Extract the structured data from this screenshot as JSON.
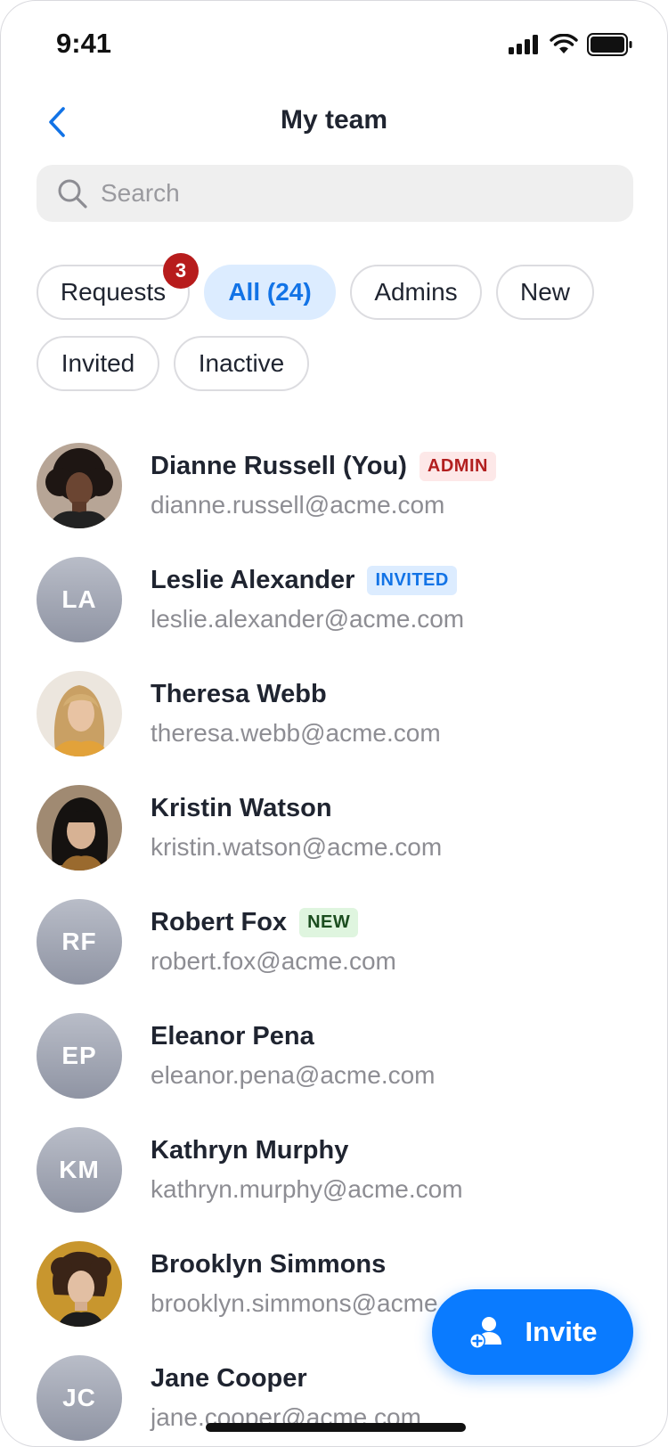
{
  "status_bar": {
    "time": "9:41"
  },
  "header": {
    "title": "My team"
  },
  "search": {
    "placeholder": "Search"
  },
  "filters": [
    {
      "label": "Requests",
      "badge": "3",
      "active": false
    },
    {
      "label": "All (24)",
      "active": true
    },
    {
      "label": "Admins",
      "active": false
    },
    {
      "label": "New",
      "active": false
    },
    {
      "label": "Invited",
      "active": false
    },
    {
      "label": "Inactive",
      "active": false
    }
  ],
  "members": [
    {
      "name": "Dianne Russell (You)",
      "email": "dianne.russell@acme.com",
      "tag": "ADMIN",
      "avatar": "photo"
    },
    {
      "name": "Leslie Alexander",
      "email": "leslie.alexander@acme.com",
      "tag": "INVITED",
      "initials": "LA"
    },
    {
      "name": "Theresa Webb",
      "email": "theresa.webb@acme.com",
      "avatar": "photo"
    },
    {
      "name": "Kristin Watson",
      "email": "kristin.watson@acme.com",
      "avatar": "photo"
    },
    {
      "name": "Robert Fox",
      "email": "robert.fox@acme.com",
      "tag": "NEW",
      "initials": "RF"
    },
    {
      "name": "Eleanor Pena",
      "email": "eleanor.pena@acme.com",
      "initials": "EP"
    },
    {
      "name": "Kathryn Murphy",
      "email": "kathryn.murphy@acme.com",
      "initials": "KM"
    },
    {
      "name": "Brooklyn Simmons",
      "email": "brooklyn.simmons@acme.com",
      "avatar": "photo"
    },
    {
      "name": "Jane Cooper",
      "email": "jane.cooper@acme.com",
      "initials": "JC"
    }
  ],
  "fab": {
    "label": "Invite",
    "icon": "add-person-icon"
  },
  "colors": {
    "accent": "#0a7bff",
    "badge": "#b71c1c",
    "admin": "#b21f1f",
    "invited": "#1273e6",
    "new": "#1b4d1f"
  }
}
